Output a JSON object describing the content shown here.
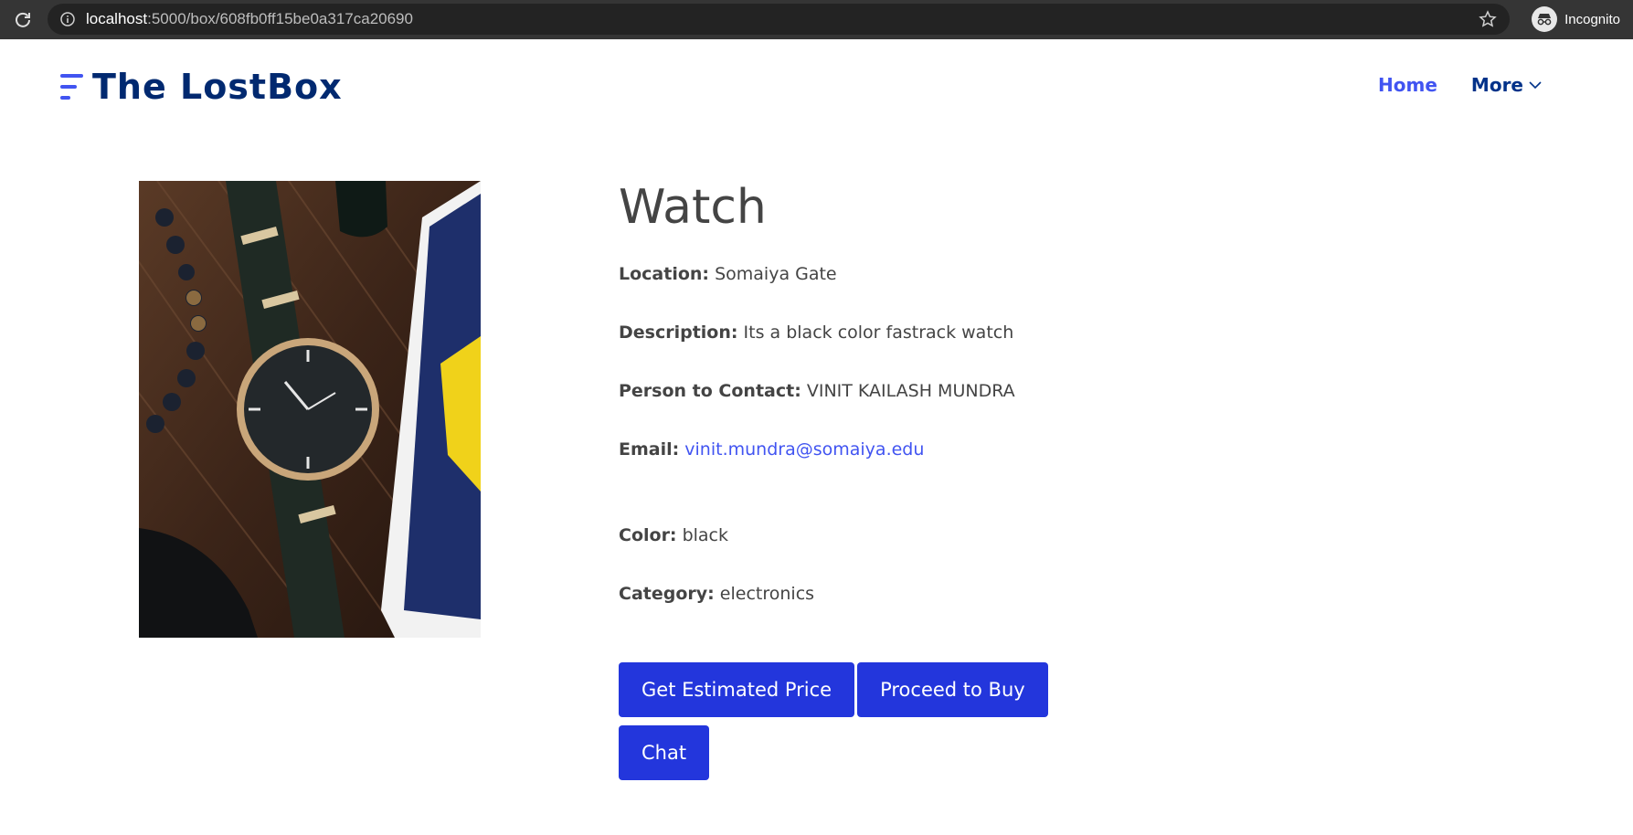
{
  "browser": {
    "url_host": "localhost",
    "url_path": ":5000/box/608fb0ff15be0a317ca20690",
    "profile_label": "Incognito"
  },
  "header": {
    "logo_text": "The LostBox",
    "nav": [
      {
        "label": "Home",
        "active": true
      },
      {
        "label": "More",
        "has_dropdown": true
      }
    ]
  },
  "item": {
    "title": "Watch",
    "fields": [
      {
        "label": "Location:",
        "value": "Somaiya Gate"
      },
      {
        "label": "Description:",
        "value": "Its a black color fastrack watch"
      },
      {
        "label": "Person to Contact:",
        "value": "VINIT KAILASH MUNDRA"
      },
      {
        "label": "Email:",
        "value": "vinit.mundra@somaiya.edu"
      },
      {
        "label": "Color:",
        "value": "black"
      },
      {
        "label": "Category:",
        "value": "electronics"
      }
    ]
  },
  "actions": {
    "estimate_label": "Get Estimated Price",
    "buy_label": "Proceed to Buy",
    "chat_label": "Chat"
  },
  "colors": {
    "accent": "#4154f1",
    "button": "#2336dc",
    "brand_dark": "#012970"
  }
}
